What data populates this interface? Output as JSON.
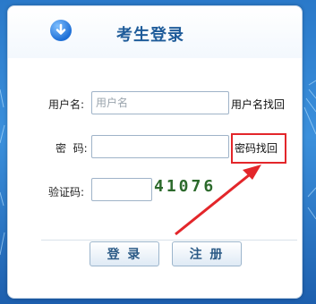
{
  "header": {
    "title": "考生登录",
    "icon": "arrow-down-circle-icon"
  },
  "form": {
    "username": {
      "label": "用户名:",
      "placeholder": "用户名",
      "value": "",
      "link": "用户名找回"
    },
    "password": {
      "label": "密  码:",
      "value": "",
      "link": "密码找回"
    },
    "captcha": {
      "label": "验证码:",
      "value": "",
      "code": "41076"
    }
  },
  "buttons": {
    "login": "登 录",
    "register": "注 册"
  },
  "colors": {
    "accent": "#1f5c9a",
    "highlight": "#e3262a",
    "background": "#2a79c9"
  }
}
